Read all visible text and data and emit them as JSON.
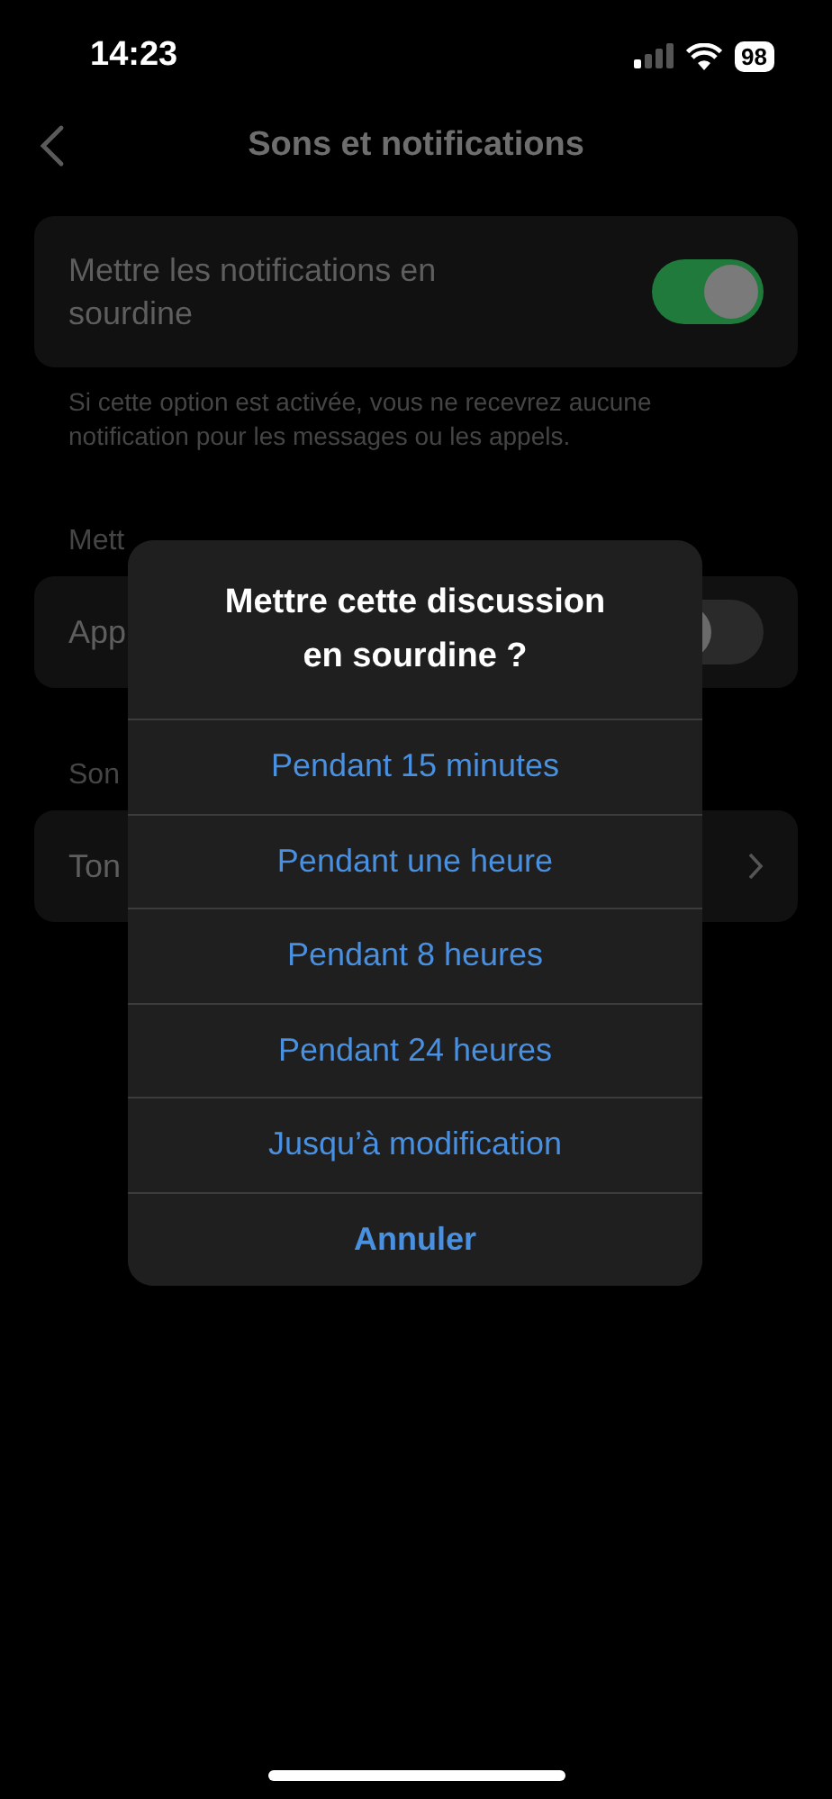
{
  "status_bar": {
    "time": "14:23",
    "battery": "98"
  },
  "nav": {
    "title": "Sons et notifications"
  },
  "mute_card": {
    "label": "Mettre les notifications en sourdine",
    "on": true
  },
  "mute_note": "Si cette option est activée, vous ne recevrez aucune notification pour les messages ou les appels.",
  "sections": [
    {
      "header": "Mett",
      "rows": [
        {
          "kind": "toggle",
          "label": "App",
          "on": false
        }
      ]
    },
    {
      "header": "Son",
      "rows": [
        {
          "kind": "link",
          "label": "Ton"
        }
      ]
    }
  ],
  "dialog": {
    "title": "Mettre cette discussion en sourdine ?",
    "options": [
      {
        "label": "Pendant 15 minutes",
        "kind": "option"
      },
      {
        "label": "Pendant une heure",
        "kind": "option"
      },
      {
        "label": "Pendant 8 heures",
        "kind": "option"
      },
      {
        "label": "Pendant 24 heures",
        "kind": "option"
      },
      {
        "label": "Jusqu’à modification",
        "kind": "option"
      },
      {
        "label": "Annuler",
        "kind": "cancel"
      }
    ]
  }
}
